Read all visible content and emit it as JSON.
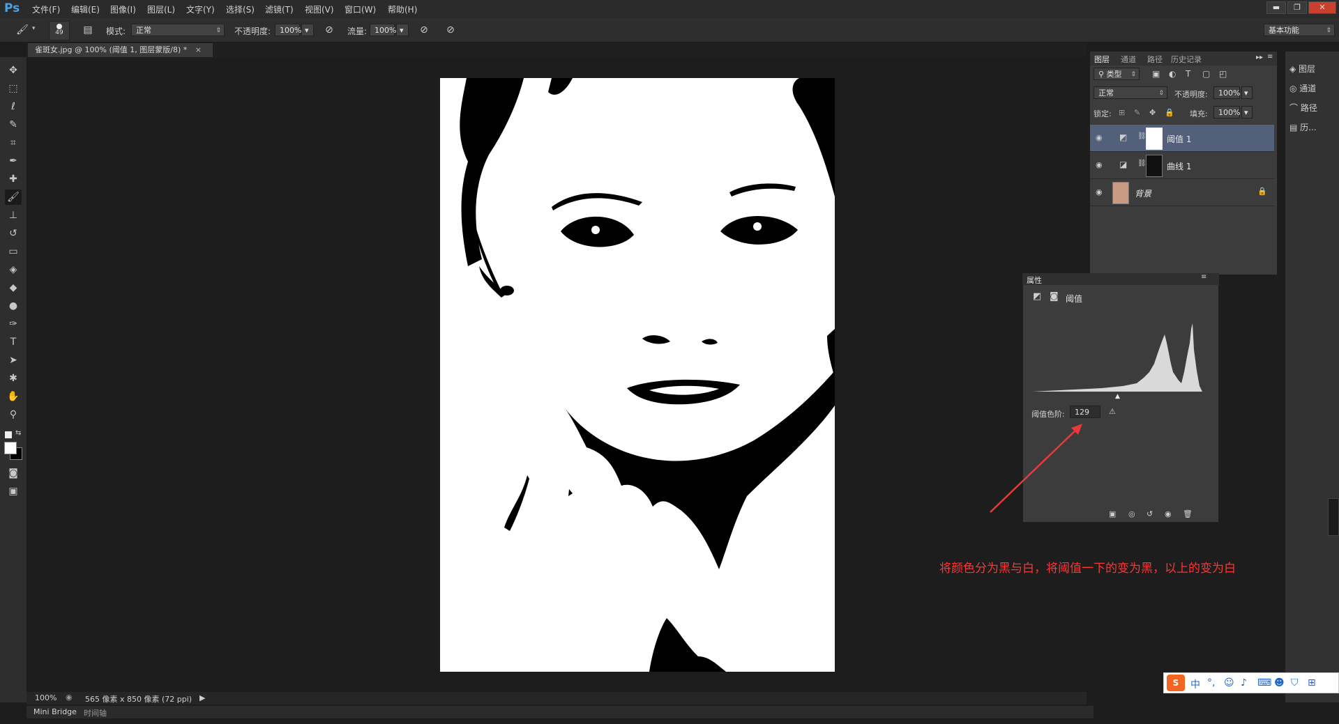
{
  "app": {
    "logo": "Ps"
  },
  "menu": [
    "文件(F)",
    "编辑(E)",
    "图像(I)",
    "图层(L)",
    "文字(Y)",
    "选择(S)",
    "滤镜(T)",
    "视图(V)",
    "窗口(W)",
    "帮助(H)"
  ],
  "window_controls": {
    "minimize": "▬",
    "restore": "❐",
    "close": "✕"
  },
  "options": {
    "brush_size": "49",
    "mode_label": "模式:",
    "mode_value": "正常",
    "opacity_label": "不透明度:",
    "opacity_value": "100%",
    "flow_label": "流量:",
    "flow_value": "100%",
    "workspace": "基本功能"
  },
  "document": {
    "tab_title": "雀斑女.jpg @ 100% (阈值 1, 图层蒙版/8) *",
    "close": "×"
  },
  "status": {
    "zoom": "100%",
    "info": "565 像素 x 850 像素 (72 ppi)"
  },
  "bottom_tabs": [
    "Mini Bridge",
    "时间轴"
  ],
  "layers_panel": {
    "tabs": [
      "图层",
      "通道",
      "路径",
      "历史记录"
    ],
    "kind_filter": "类型",
    "blend_mode": "正常",
    "opacity_label": "不透明度:",
    "opacity_value": "100%",
    "lock_label": "锁定:",
    "fill_label": "填充:",
    "fill_value": "100%",
    "layers": [
      {
        "name": "阈值 1",
        "selected": true
      },
      {
        "name": "曲线 1",
        "selected": false
      },
      {
        "name": "背景",
        "selected": false,
        "locked": true
      }
    ]
  },
  "dock": [
    "图层",
    "通道",
    "路径",
    "历..."
  ],
  "properties_panel": {
    "title": "属性",
    "adjustment_name": "阈值",
    "threshold_label": "阈值色阶:",
    "threshold_value": "129",
    "threshold_level": 129
  },
  "annotation": "将颜色分为黑与白，将阈值一下的变为黑，以上的变为白",
  "ime": {
    "chinese": "中"
  },
  "colors": {
    "accent": "#4aa3e0",
    "selected_layer": "#52607a",
    "annotation": "#ff3535",
    "ime_logo": "#f26522"
  }
}
